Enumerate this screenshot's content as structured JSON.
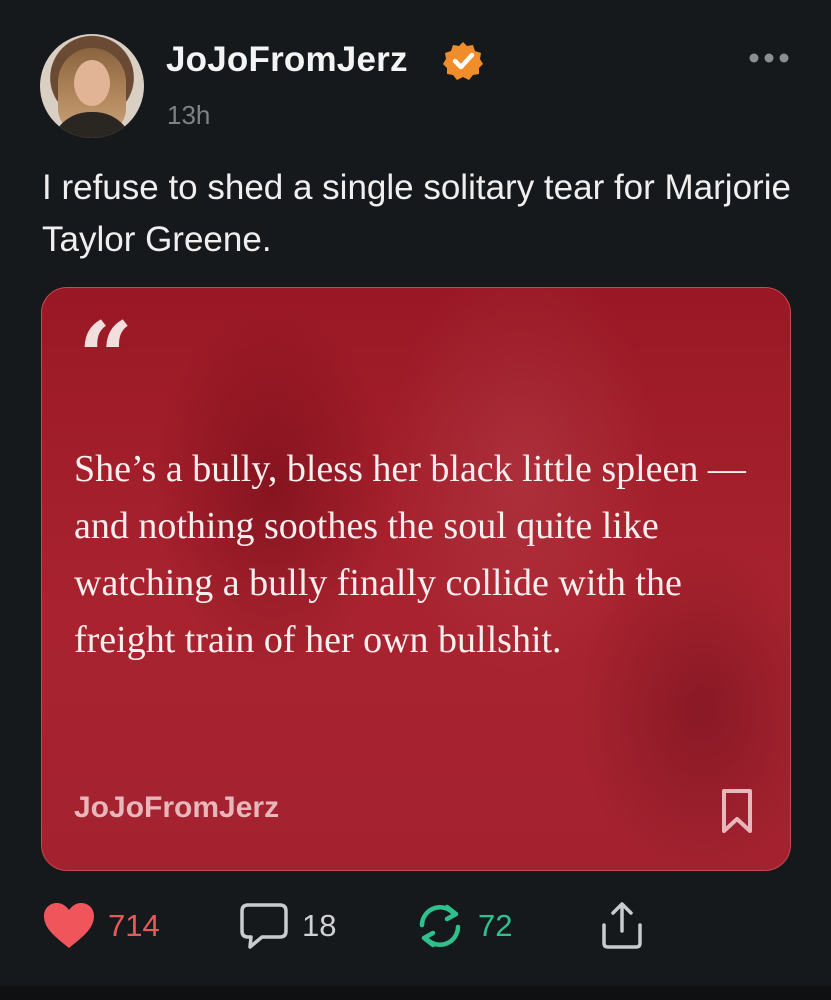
{
  "post": {
    "username": "JoJoFromJerz",
    "timestamp": "13h",
    "text": "I refuse to shed a single solitary tear for Marjorie Taylor Greene."
  },
  "quote_card": {
    "quote": "She’s a bully, bless her black little spleen — and nothing soothes the soul quite like watching a bully finally collide with the freight train of her own bullshit.",
    "author": "JoJoFromJerz"
  },
  "actions": {
    "likes": "714",
    "comments": "18",
    "restacks": "72"
  },
  "colors": {
    "background": "#16191b",
    "card": "#a3202c",
    "like": "#e85a5a",
    "restack": "#2fc18d",
    "verified": "#f08c2a"
  },
  "icons": {
    "verified": "verified-check-icon",
    "more": "more-dots-icon",
    "quote": "quote-mark-icon",
    "bookmark": "bookmark-icon",
    "like": "heart-icon",
    "comment": "comment-bubble-icon",
    "restack": "restack-icon",
    "share": "share-icon"
  }
}
